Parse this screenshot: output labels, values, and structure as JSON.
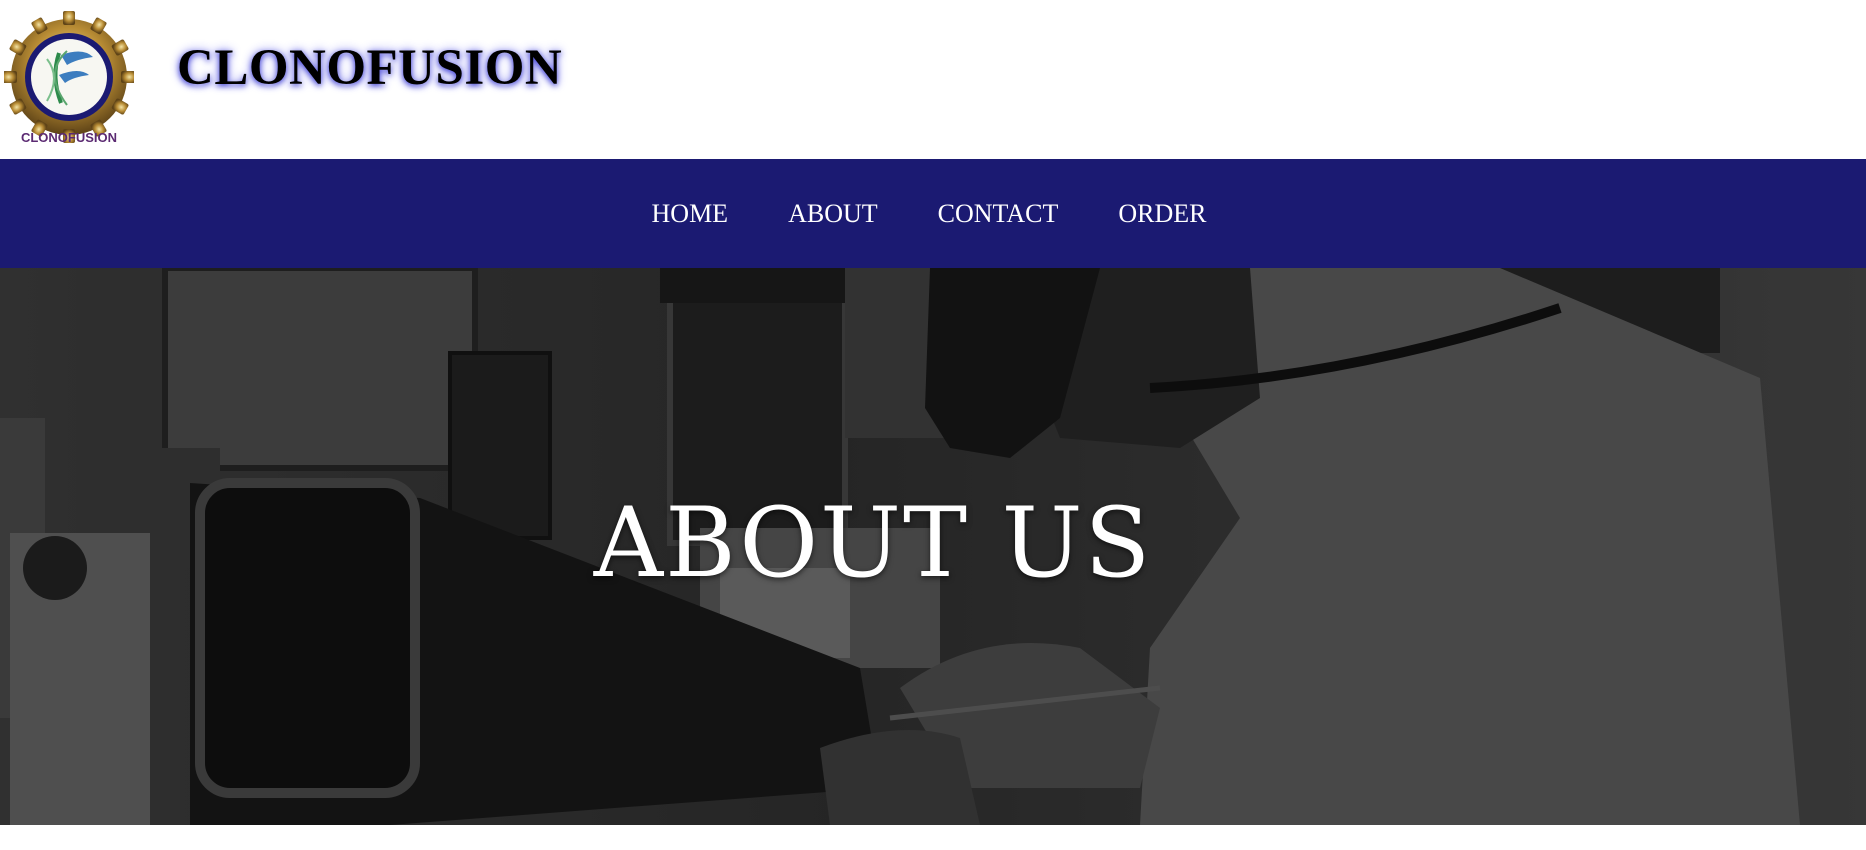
{
  "header": {
    "brand_name": "CLONOFUSION",
    "logo": {
      "icon": "gear-dna-logo-icon",
      "ring_text": "CLONOFUSION",
      "accent": "#c9a44a"
    }
  },
  "nav": {
    "items": [
      {
        "label": "HOME"
      },
      {
        "label": "ABOUT"
      },
      {
        "label": "CONTACT"
      },
      {
        "label": "ORDER"
      }
    ],
    "background": "#1b1a72"
  },
  "hero": {
    "title": "ABOUT US",
    "image": "taxidermist-workshop-photo"
  }
}
